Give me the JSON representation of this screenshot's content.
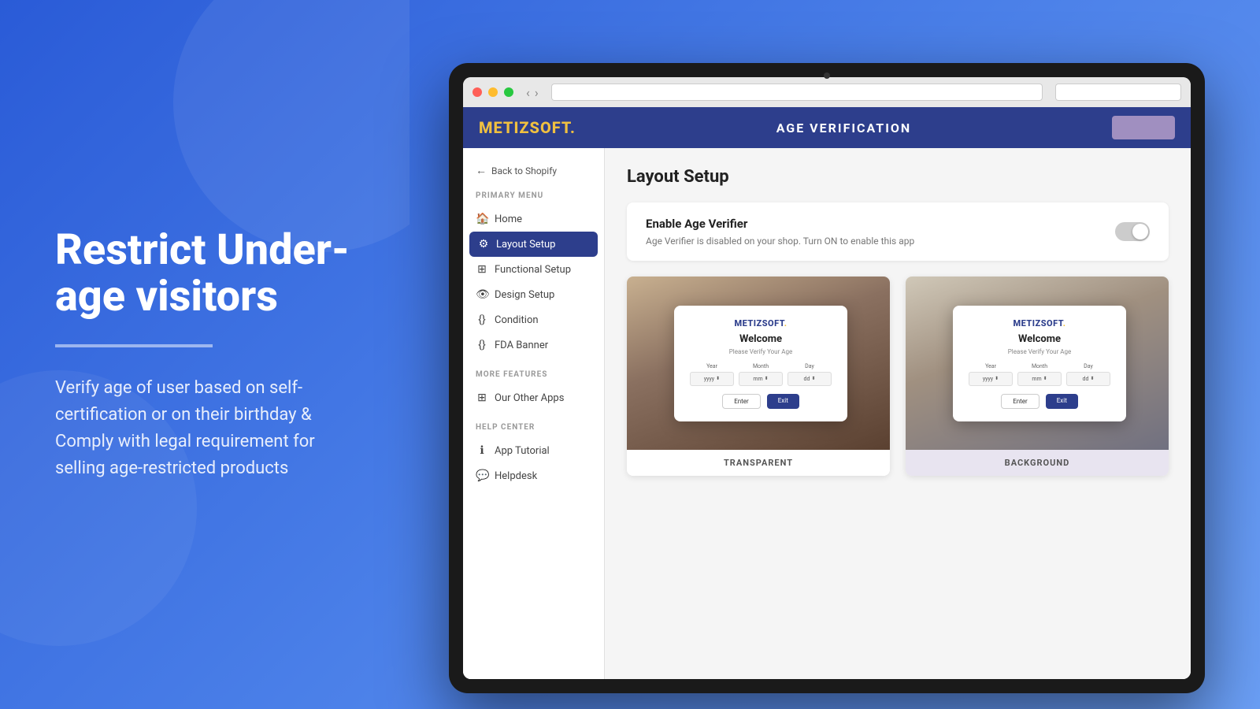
{
  "left": {
    "title": "Restrict Under-age visitors",
    "description": "Verify age of user based on self-certification or on their birthday & Comply with legal requirement for selling age-restricted products"
  },
  "browser": {
    "camera_dot": true
  },
  "app": {
    "logo": "METIZSOFT.",
    "header_title": "AGE VERIFICATION",
    "back_label": "Back to Shopify",
    "primary_menu_label": "PRIMARY MENU",
    "menu_items": [
      {
        "id": "home",
        "label": "Home",
        "icon": "🏠",
        "active": false
      },
      {
        "id": "layout-setup",
        "label": "Layout Setup",
        "icon": "⚙",
        "active": true
      },
      {
        "id": "functional-setup",
        "label": "Functional Setup",
        "icon": "⊞",
        "active": false
      },
      {
        "id": "design-setup",
        "label": "Design Setup",
        "icon": "👁",
        "active": false
      },
      {
        "id": "condition",
        "label": "Condition",
        "icon": "({})",
        "active": false
      },
      {
        "id": "fda-banner",
        "label": "FDA Banner",
        "icon": "({})",
        "active": false
      }
    ],
    "more_features_label": "MORE FEATURES",
    "more_features_items": [
      {
        "id": "our-other-apps",
        "label": "Our Other Apps",
        "icon": "⊞"
      }
    ],
    "help_center_label": "HELP CENTER",
    "help_items": [
      {
        "id": "app-tutorial",
        "label": "App Tutorial",
        "icon": "ℹ"
      },
      {
        "id": "helpdesk",
        "label": "Helpdesk",
        "icon": "💬"
      }
    ],
    "page_title": "Layout Setup",
    "enable_section": {
      "title": "Enable Age Verifier",
      "description": "Age Verifier is disabled on your shop. Turn ON to enable this app",
      "toggle_state": "off"
    },
    "layouts": [
      {
        "id": "transparent",
        "label": "TRANSPARENT",
        "modal": {
          "logo": "METIZSOFT.",
          "welcome": "Welcome",
          "subtitle": "Please Verify Your Age",
          "year_label": "Year",
          "month_label": "Month",
          "day_label": "Day",
          "year_placeholder": "yyyy",
          "month_placeholder": "mm",
          "day_placeholder": "dd",
          "enter_label": "Enter",
          "exit_label": "Exit"
        }
      },
      {
        "id": "background",
        "label": "BACKGROUND",
        "modal": {
          "logo": "METIZSOFT.",
          "welcome": "Welcome",
          "subtitle": "Please Verify Your Age",
          "year_label": "Year",
          "month_label": "Month",
          "day_label": "Day",
          "year_placeholder": "yyyy",
          "month_placeholder": "mm",
          "day_placeholder": "dd",
          "enter_label": "Enter",
          "exit_label": "Exit"
        }
      }
    ]
  }
}
